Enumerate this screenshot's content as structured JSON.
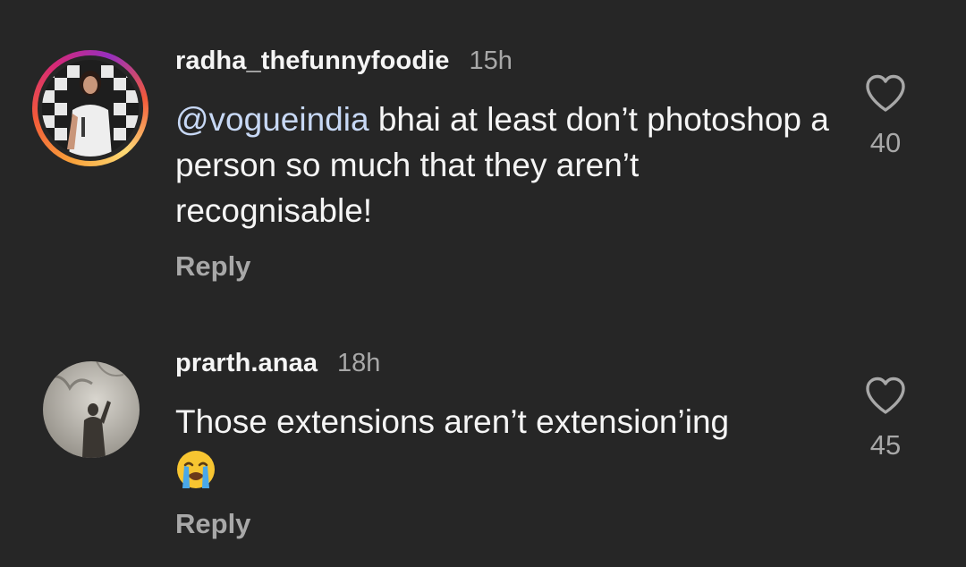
{
  "comments": [
    {
      "username": "radha_thefunnyfoodie",
      "time": "15h",
      "mention": "@vogueindia",
      "text": "bhai at least don’t photoshop a person so much that they aren’t recognisable!",
      "reply_label": "Reply",
      "likes": "40",
      "avatar_story_ring": true
    },
    {
      "username": "prarth.anaa",
      "time": "18h",
      "text": "Those extensions aren’t extension’ing",
      "emoji": "loudly-crying-face",
      "reply_label": "Reply",
      "likes": "45",
      "avatar_story_ring": false
    }
  ],
  "icons": {
    "like": "heart-outline-icon"
  },
  "colors": {
    "background": "#262626",
    "text": "#f5f5f5",
    "secondary": "#a8a8a8",
    "mention": "#c7d8f5"
  }
}
